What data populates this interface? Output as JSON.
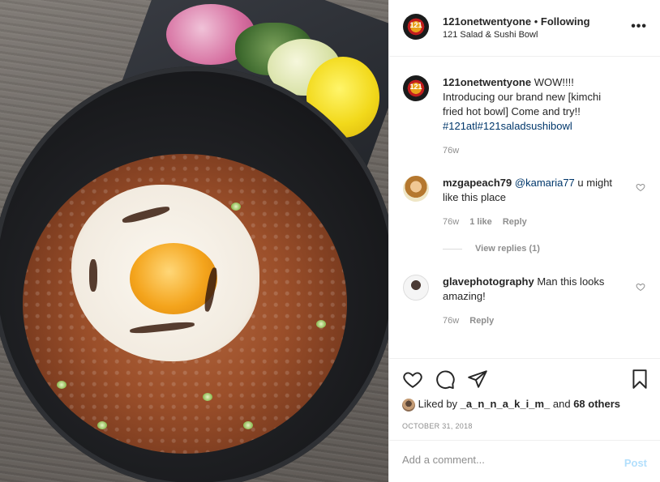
{
  "header": {
    "username": "121onetwentyone",
    "separator": " • ",
    "follow_status": "Following",
    "location": "121 Salad & Sushi Bowl",
    "more_icon": "more-horizontal-icon"
  },
  "caption": {
    "username": "121onetwentyone",
    "text": "WOW!!!! Introducing our brand new [kimchi fried hot bowl] Come and try!!",
    "hashtags": "#121atl#121saladsushibowl",
    "age": "76w"
  },
  "comments": [
    {
      "username": "mzgapeach79",
      "mention": "@kamaria77",
      "text": " u might like this place",
      "age": "76w",
      "likes": "1 like",
      "reply_label": "Reply",
      "view_replies": "View replies (1)"
    },
    {
      "username": "glavephotography",
      "text": "Man this looks amazing!",
      "age": "76w",
      "reply_label": "Reply"
    }
  ],
  "actions": {
    "like_icon": "heart-icon",
    "comment_icon": "comment-icon",
    "share_icon": "paper-plane-icon",
    "save_icon": "bookmark-icon"
  },
  "likes": {
    "prefix": "Liked by ",
    "user": "_a_n_n_a_k_i_m_",
    "middle": " and ",
    "others": "68 others"
  },
  "date": "October 31, 2018",
  "add_comment": {
    "placeholder": "Add a comment...",
    "post_label": "Post"
  },
  "colors": {
    "link": "#00376b",
    "muted": "#8e8e8e",
    "post_disabled": "#b2dffc"
  }
}
